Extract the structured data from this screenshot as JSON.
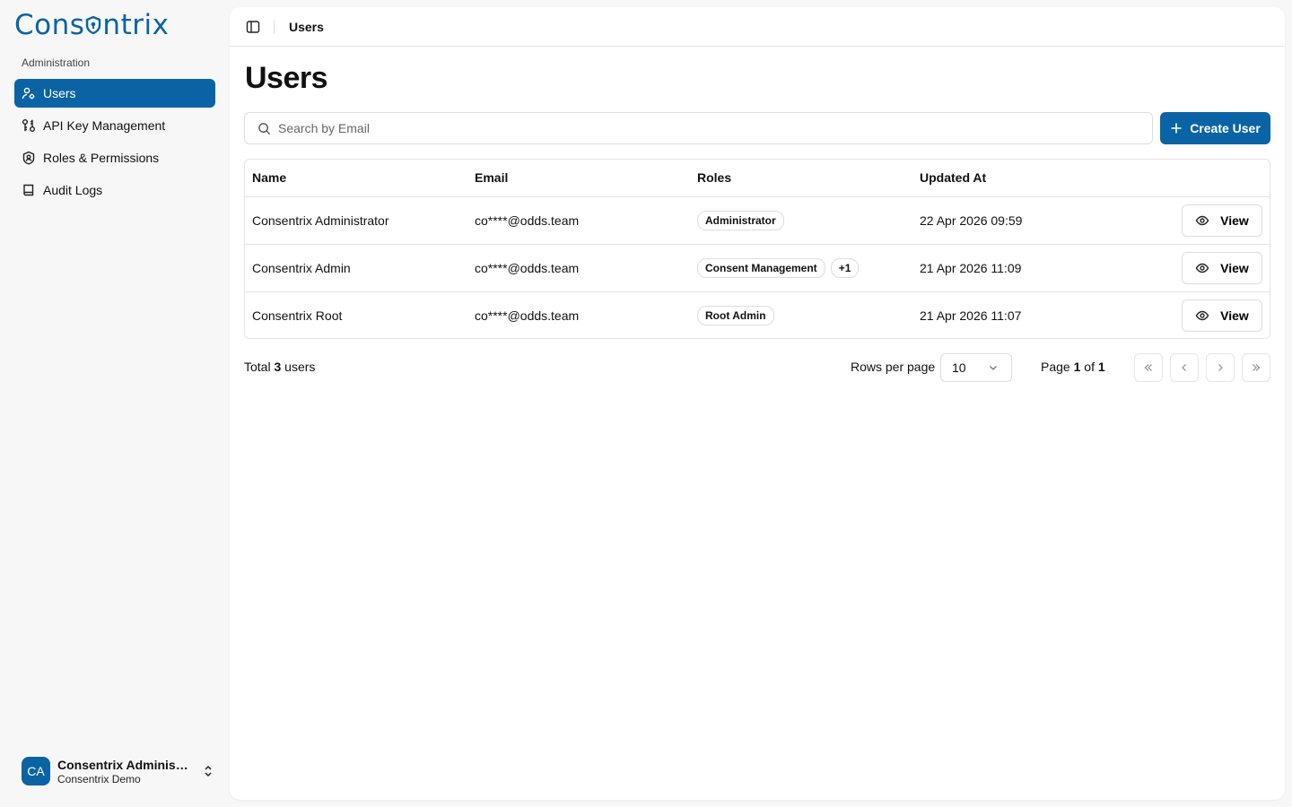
{
  "app": {
    "logo_text_a": "Cons",
    "logo_text_b": "ntrix"
  },
  "sidebar": {
    "section_label": "Administration",
    "items": [
      {
        "label": "Users",
        "icon": "users-icon",
        "active": true
      },
      {
        "label": "API Key Management",
        "icon": "key-icon"
      },
      {
        "label": "Roles & Permissions",
        "icon": "shield-icon"
      },
      {
        "label": "Audit Logs",
        "icon": "book-icon"
      }
    ],
    "user": {
      "initials": "CA",
      "name": "Consentrix Administrator",
      "org": "Consentrix Demo"
    }
  },
  "header": {
    "breadcrumb": "Users"
  },
  "main": {
    "title": "Users",
    "search_placeholder": "Search by Email",
    "create_label": "Create User",
    "columns": {
      "name": "Name",
      "email": "Email",
      "roles": "Roles",
      "updated": "Updated At"
    },
    "rows": [
      {
        "name": "Consentrix Administrator",
        "email": "co****@odds.team",
        "roles": [
          "Administrator"
        ],
        "updated": "22 Apr 2026 09:59",
        "action": "View"
      },
      {
        "name": "Consentrix Admin",
        "email": "co****@odds.team",
        "roles": [
          "Consent Management",
          "+1"
        ],
        "updated": "21 Apr 2026 11:09",
        "action": "View"
      },
      {
        "name": "Consentrix Root",
        "email": "co****@odds.team",
        "roles": [
          "Root Admin"
        ],
        "updated": "21 Apr 2026 11:07",
        "action": "View"
      }
    ],
    "footer": {
      "total_prefix": "Total ",
      "total_count": "3",
      "total_suffix": " users",
      "rows_per_page_label": "Rows per page",
      "rows_per_page_value": "10",
      "page_prefix": "Page ",
      "page_current": "1",
      "page_of": " of ",
      "page_total": "1"
    }
  },
  "colors": {
    "accent": "#0a63a4"
  }
}
